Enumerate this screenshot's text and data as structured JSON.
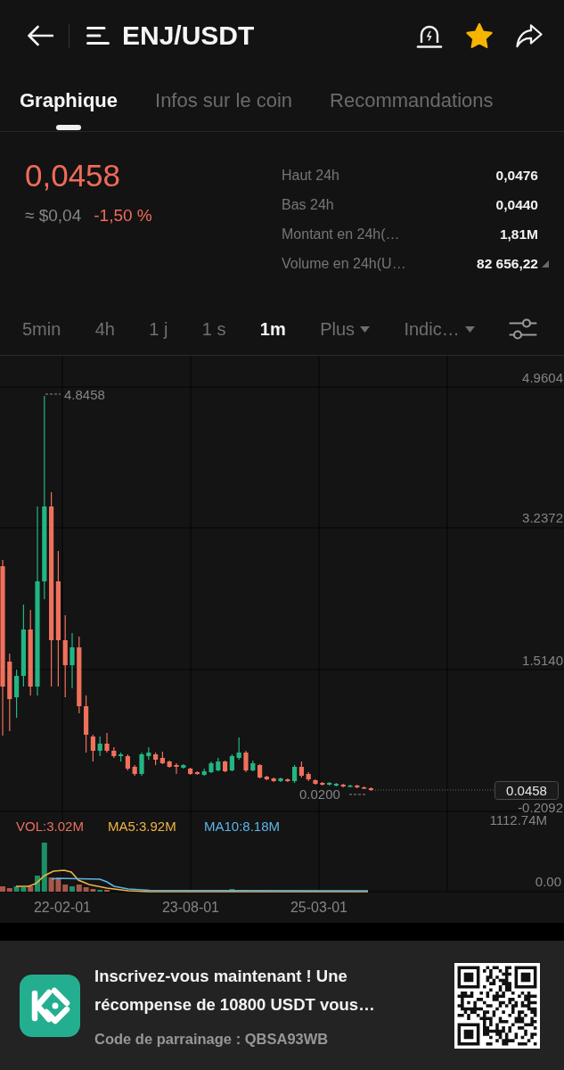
{
  "header": {
    "title": "ENJ/USDT",
    "favorite": true
  },
  "tabs": [
    {
      "label": "Graphique",
      "selected": true
    },
    {
      "label": "Infos sur le coin",
      "selected": false
    },
    {
      "label": "Recommandations",
      "selected": false
    }
  ],
  "ticker": {
    "price": "0,0458",
    "fiat_price": "≈ $0,04",
    "change": "-1,50 %",
    "rising": false
  },
  "stats": [
    {
      "label": "Haut 24h",
      "value": "0,0476",
      "expandable": false
    },
    {
      "label": "Bas 24h",
      "value": "0,0440",
      "expandable": false
    },
    {
      "label": "Montant en 24h(…",
      "value": "1,81M",
      "expandable": false
    },
    {
      "label": "Volume en 24h(U…",
      "value": "82 656,22",
      "expandable": true
    }
  ],
  "intervals": [
    {
      "label": "5min",
      "kind": "plain",
      "selected": false
    },
    {
      "label": "4h",
      "kind": "plain",
      "selected": false
    },
    {
      "label": "1 j",
      "kind": "plain",
      "selected": false
    },
    {
      "label": "1 s",
      "kind": "plain",
      "selected": false
    },
    {
      "label": "1m",
      "kind": "plain",
      "selected": true
    },
    {
      "label": "Plus",
      "kind": "dropdown",
      "selected": false
    },
    {
      "label": "Indic…",
      "kind": "dropdown",
      "selected": false
    }
  ],
  "chart": {
    "price_axis": [
      "4.9604",
      "3.2372",
      "1.5140",
      "-0.2092"
    ],
    "high_label": "4.8458",
    "low_label": "0.0200",
    "last_price": "0.0458",
    "volume_legend": [
      {
        "label": "VOL:3.02M",
        "color": "#e8705f"
      },
      {
        "label": "MA5:3.92M",
        "color": "#f0b445"
      },
      {
        "label": "MA10:8.18M",
        "color": "#5fb4e6"
      }
    ],
    "volume_axis": [
      "1112.74M",
      "0.00"
    ],
    "date_axis": [
      "22-02-01",
      "23-08-01",
      "25-03-01"
    ]
  },
  "promo": {
    "headline": "Inscrivez-vous maintenant ! Une récompense de 10800 USDT vous…",
    "referral": "Code de parrainage : QBSA93WB"
  }
}
